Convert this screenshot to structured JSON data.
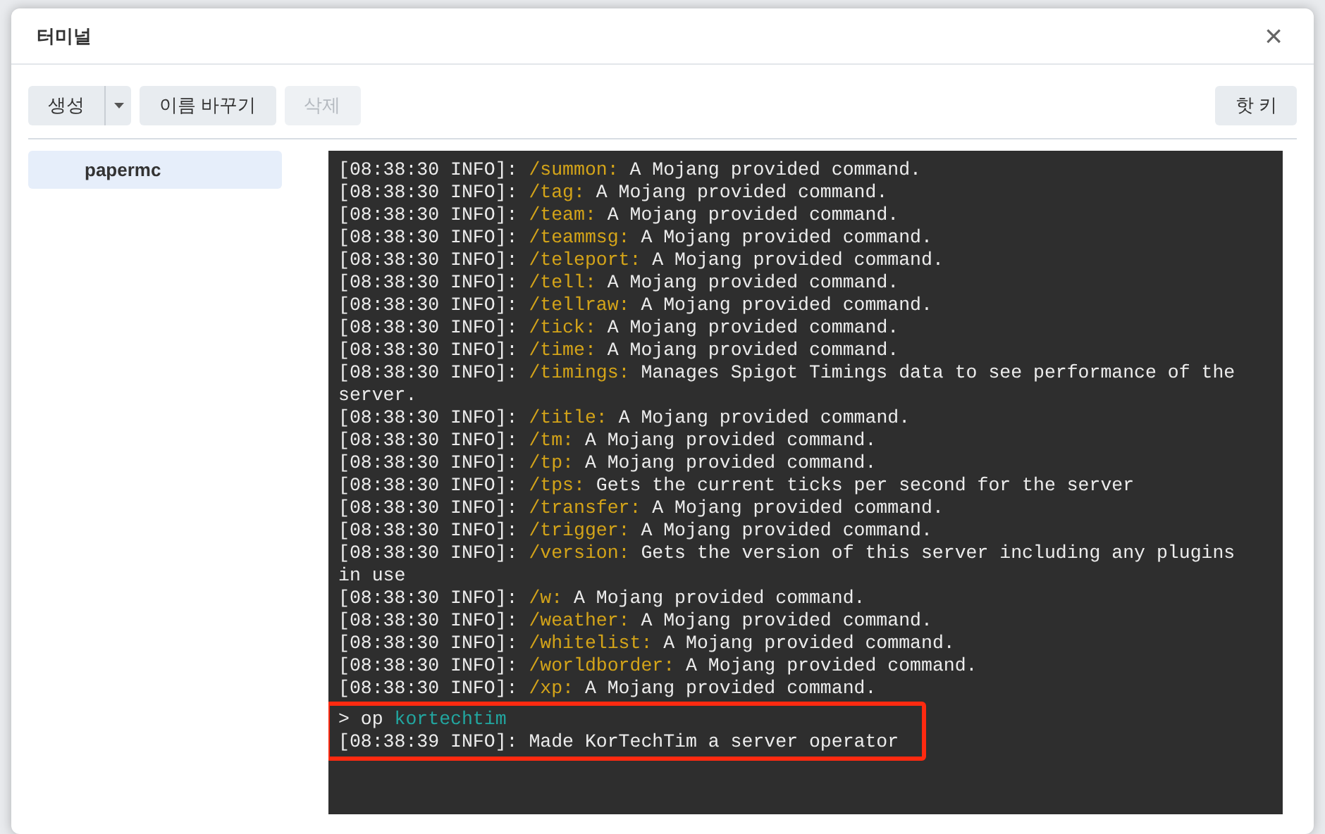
{
  "window": {
    "title": "터미널",
    "close": "×"
  },
  "toolbar": {
    "buttons": [
      {
        "kind": "split",
        "label": "생성",
        "disabled": false
      },
      {
        "kind": "plain",
        "label": "이름 바꾸기",
        "disabled": false
      },
      {
        "kind": "plain",
        "label": "삭제",
        "disabled": true
      }
    ],
    "right_button": {
      "label": "핫 키"
    }
  },
  "sidebar": {
    "items": [
      {
        "label": "papermc",
        "selected": true
      }
    ]
  },
  "terminal": {
    "lines": [
      {
        "kind": "log",
        "prefix": "[08:38:30 INFO]:",
        "command": "/summon:",
        "message": "A Mojang provided command."
      },
      {
        "kind": "log",
        "prefix": "[08:38:30 INFO]:",
        "command": "/tag:",
        "message": "A Mojang provided command."
      },
      {
        "kind": "log",
        "prefix": "[08:38:30 INFO]:",
        "command": "/team:",
        "message": "A Mojang provided command."
      },
      {
        "kind": "log",
        "prefix": "[08:38:30 INFO]:",
        "command": "/teammsg:",
        "message": "A Mojang provided command."
      },
      {
        "kind": "log",
        "prefix": "[08:38:30 INFO]:",
        "command": "/teleport:",
        "message": "A Mojang provided command."
      },
      {
        "kind": "log",
        "prefix": "[08:38:30 INFO]:",
        "command": "/tell:",
        "message": "A Mojang provided command."
      },
      {
        "kind": "log",
        "prefix": "[08:38:30 INFO]:",
        "command": "/tellraw:",
        "message": "A Mojang provided command."
      },
      {
        "kind": "log",
        "prefix": "[08:38:30 INFO]:",
        "command": "/tick:",
        "message": "A Mojang provided command."
      },
      {
        "kind": "log",
        "prefix": "[08:38:30 INFO]:",
        "command": "/time:",
        "message": "A Mojang provided command."
      },
      {
        "kind": "log",
        "prefix": "[08:38:30 INFO]:",
        "command": "/timings:",
        "message": "Manages Spigot Timings data to see performance of the server."
      },
      {
        "kind": "log",
        "prefix": "[08:38:30 INFO]:",
        "command": "/title:",
        "message": "A Mojang provided command."
      },
      {
        "kind": "log",
        "prefix": "[08:38:30 INFO]:",
        "command": "/tm:",
        "message": "A Mojang provided command."
      },
      {
        "kind": "log",
        "prefix": "[08:38:30 INFO]:",
        "command": "/tp:",
        "message": "A Mojang provided command."
      },
      {
        "kind": "log",
        "prefix": "[08:38:30 INFO]:",
        "command": "/tps:",
        "message": "Gets the current ticks per second for the server"
      },
      {
        "kind": "log",
        "prefix": "[08:38:30 INFO]:",
        "command": "/transfer:",
        "message": "A Mojang provided command."
      },
      {
        "kind": "log",
        "prefix": "[08:38:30 INFO]:",
        "command": "/trigger:",
        "message": "A Mojang provided command."
      },
      {
        "kind": "log",
        "prefix": "[08:38:30 INFO]:",
        "command": "/version:",
        "message": "Gets the version of this server including any plugins in use"
      },
      {
        "kind": "log",
        "prefix": "[08:38:30 INFO]:",
        "command": "/w:",
        "message": "A Mojang provided command."
      },
      {
        "kind": "log",
        "prefix": "[08:38:30 INFO]:",
        "command": "/weather:",
        "message": "A Mojang provided command."
      },
      {
        "kind": "log",
        "prefix": "[08:38:30 INFO]:",
        "command": "/whitelist:",
        "message": "A Mojang provided command."
      },
      {
        "kind": "log",
        "prefix": "[08:38:30 INFO]:",
        "command": "/worldborder:",
        "message": "A Mojang provided command."
      },
      {
        "kind": "log",
        "prefix": "[08:38:30 INFO]:",
        "command": "/xp:",
        "message": "A Mojang provided command."
      }
    ],
    "highlighted_lines": [
      {
        "kind": "input",
        "prefix": ">",
        "command": "op",
        "argument": "kortechtim"
      },
      {
        "kind": "log",
        "prefix": "[08:38:39 INFO]:",
        "message": "Made KorTechTim a server operator"
      }
    ]
  }
}
